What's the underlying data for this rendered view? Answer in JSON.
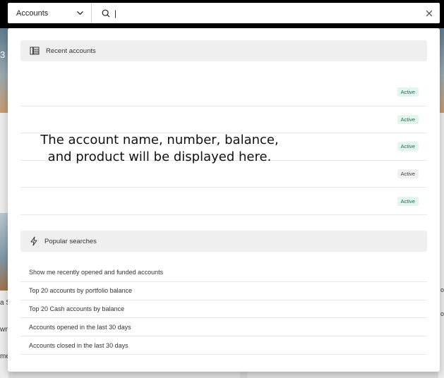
{
  "search": {
    "scope_label": "Accounts",
    "query": "|",
    "placeholder": ""
  },
  "recent": {
    "title": "Recent accounts",
    "placeholder_message": "The account name, number, balance, and product will be displayed here.",
    "rows": [
      {
        "status": "Active",
        "tone": "green"
      },
      {
        "status": "Active",
        "tone": "green"
      },
      {
        "status": "Active",
        "tone": "green"
      },
      {
        "status": "Active",
        "tone": "grey"
      },
      {
        "status": "Active",
        "tone": "green"
      }
    ]
  },
  "popular": {
    "title": "Popular searches",
    "items": [
      "Show me recently opened and funded accounts",
      "Top 20 accounts by portfolio balance",
      "Top 20 Cash accounts by balance",
      "Accounts opened in the last 30 days",
      "Accounts closed in the last 30 days"
    ]
  },
  "backdrop_fragments": [
    "3",
    "a S",
    "wn",
    "me",
    "o",
    "o"
  ],
  "colors": {
    "active_badge_bg": "#e3f6ee",
    "active_badge_text": "#1d6b4a",
    "section_header_bg": "#efefef"
  },
  "icons": {
    "scope_chevron": "chevron-down-icon",
    "search": "search-icon",
    "clear": "close-icon",
    "recent": "accounts-stack-icon",
    "popular": "lightning-icon"
  }
}
